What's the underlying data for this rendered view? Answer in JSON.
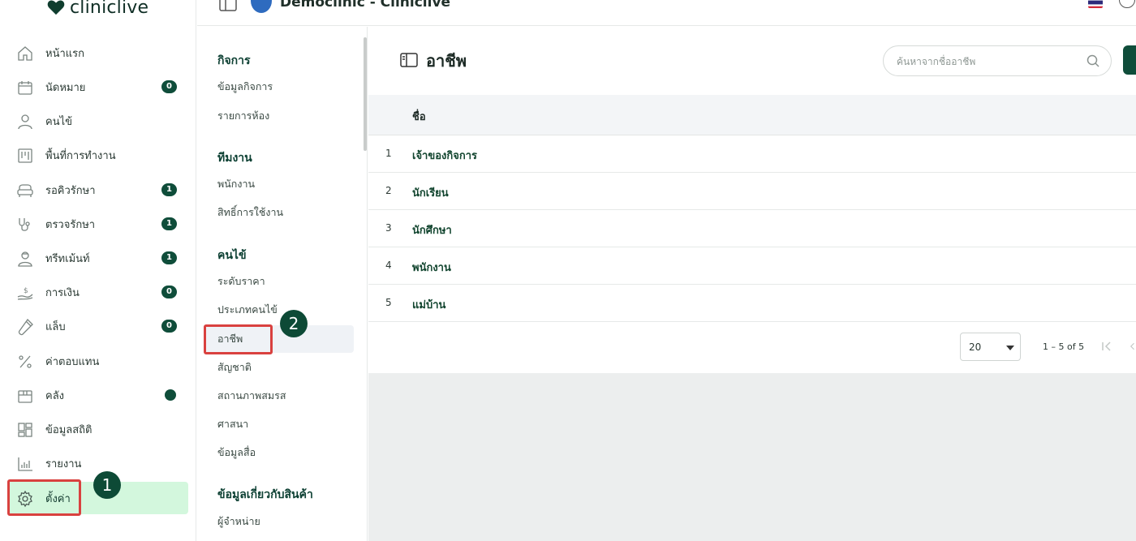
{
  "app": {
    "logo_text": "cliniclive",
    "clinic_title": "Democlinic - Cliniclive"
  },
  "sidebar": {
    "items": [
      {
        "label": "หน้าแรก",
        "icon": "home-icon"
      },
      {
        "label": "นัดหมาย",
        "icon": "calendar-icon",
        "badge": "0"
      },
      {
        "label": "คนไข้",
        "icon": "person-icon"
      },
      {
        "label": "พื้นที่การทำงาน",
        "icon": "kanban-icon"
      },
      {
        "label": "รอคิวรักษา",
        "icon": "sofa-icon",
        "badge": "1"
      },
      {
        "label": "ตรวจรักษา",
        "icon": "stethoscope-icon",
        "badge": "1"
      },
      {
        "label": "ทรีทเม้นท์",
        "icon": "doctor-icon",
        "badge": "1"
      },
      {
        "label": "การเงิน",
        "icon": "money-hand-icon",
        "badge": "0"
      },
      {
        "label": "แล็บ",
        "icon": "test-tube-icon",
        "badge": "0"
      },
      {
        "label": "ค่าตอบแทน",
        "icon": "percent-icon"
      },
      {
        "label": "คลัง",
        "icon": "box-icon",
        "dot": true
      },
      {
        "label": "ข้อมูลสถิติ",
        "icon": "dashboard-icon"
      },
      {
        "label": "รายงาน",
        "icon": "bar-chart-icon"
      },
      {
        "label": "ตั้งค่า",
        "icon": "gear-icon",
        "active": true
      }
    ]
  },
  "annotations": {
    "step1": "1",
    "step2": "2"
  },
  "submenu": {
    "sections": [
      {
        "title": "กิจการ",
        "items": [
          "ข้อมูลกิจการ",
          "รายการห้อง"
        ]
      },
      {
        "title": "ทีมงาน",
        "items": [
          "พนักงาน",
          "สิทธิ์การใช้งาน"
        ]
      },
      {
        "title": "คนไข้",
        "items": [
          "ระดับราคา",
          "ประเภทคนไข้",
          "อาชีพ",
          "สัญชาติ",
          "สถานภาพสมรส",
          "ศาสนา",
          "ข้อมูลสื่อ"
        ]
      },
      {
        "title": "ข้อมูลเกี่ยวกับสินค้า",
        "items": [
          "ผู้จำหน่าย"
        ]
      }
    ],
    "active_item": "อาชีพ"
  },
  "main": {
    "title": "อาชีพ",
    "search_placeholder": "ค้นหาจากชื่ออาชีพ",
    "table": {
      "header_name": "ชื่อ",
      "rows": [
        {
          "index": "1",
          "name": "เจ้าของกิจการ"
        },
        {
          "index": "2",
          "name": "นักเรียน"
        },
        {
          "index": "3",
          "name": "นักศึกษา"
        },
        {
          "index": "4",
          "name": "พนักงาน"
        },
        {
          "index": "5",
          "name": "แม่บ้าน"
        }
      ]
    },
    "pagination": {
      "page_size": "20",
      "range": "1 – 5 of 5"
    }
  },
  "colors": {
    "brand_dark": "#0f4d3a",
    "active_bg": "#d3f7dd",
    "highlight_red": "#d9413f"
  }
}
